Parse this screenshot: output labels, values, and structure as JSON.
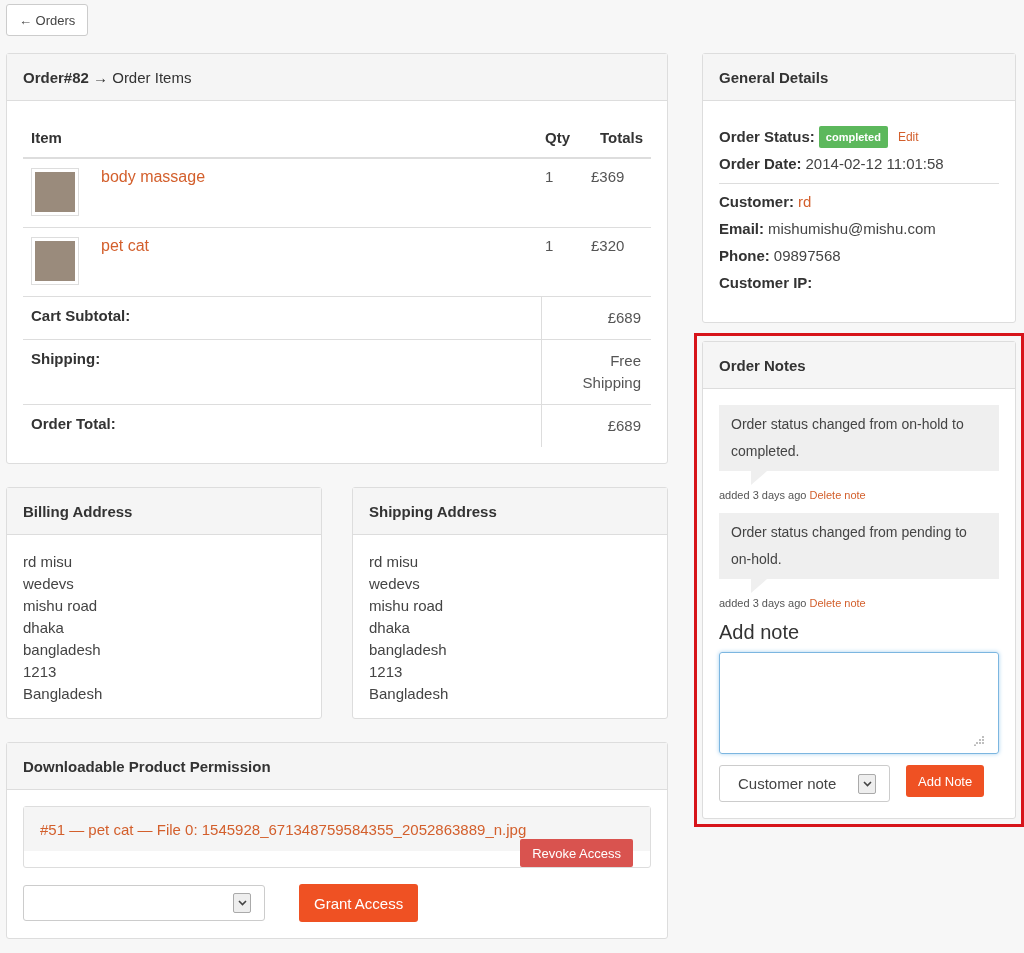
{
  "back_button": {
    "label": "← Orders"
  },
  "order_items": {
    "title": "**Order#82** → Order Items",
    "columns": [
      "Item",
      "Qty",
      "Totals"
    ],
    "items": [
      {
        "name": "body massage",
        "qty": "1",
        "total": "£369"
      },
      {
        "name": "pet cat",
        "qty": "1",
        "total": "£320"
      }
    ],
    "totals": [
      {
        "label": "Cart Subtotal:",
        "value": "£689"
      },
      {
        "label": "Shipping:",
        "value": "Free Shipping"
      },
      {
        "label": "Order Total:",
        "value": "£689"
      }
    ]
  },
  "billing_address": {
    "title": "Billing Address",
    "lines": [
      "rd misu",
      "wedevs",
      "mishu road",
      "dhaka",
      "bangladesh",
      "1213",
      "Bangladesh"
    ]
  },
  "shipping_address": {
    "title": "Shipping Address",
    "lines": [
      "rd misu",
      "wedevs",
      "mishu road",
      "dhaka",
      "bangladesh",
      "1213",
      "Bangladesh"
    ]
  },
  "downloads": {
    "title": "Downloadable Product Permission",
    "permission": "#51 — pet cat — File 0: 1545928_671348759584355_2052863889_n.jpg",
    "revoke_button": "Revoke Access",
    "grant_button": "Grant Access"
  },
  "general_details": {
    "title": "General Details",
    "status_label": "Order Status:",
    "status": "completed",
    "edit_link": "Edit",
    "order_fields": [
      {
        "label": "Order Date:",
        "value": "2014-02-12 11:01:58"
      }
    ],
    "customer_fields": [
      {
        "label": "Customer:",
        "value": "rd",
        "kind": "link"
      },
      {
        "label": "Email:",
        "value": "mishumishu@mishu.com",
        "kind": "text"
      },
      {
        "label": "Phone:",
        "value": "09897568",
        "kind": "text"
      },
      {
        "label": "Customer IP:"
      }
    ]
  },
  "order_notes": {
    "title": "Order Notes",
    "highlighted": true,
    "notes": [
      {
        "text": "Order status changed from on-hold to completed.",
        "meta": "added 3 days ago",
        "action": "Delete note"
      },
      {
        "text": "Order status changed from pending to on-hold.",
        "meta": "added 3 days ago",
        "action": "Delete note"
      }
    ],
    "add_note_heading": "Add note",
    "note_type": "Customer note",
    "add_button": "Add Note"
  }
}
